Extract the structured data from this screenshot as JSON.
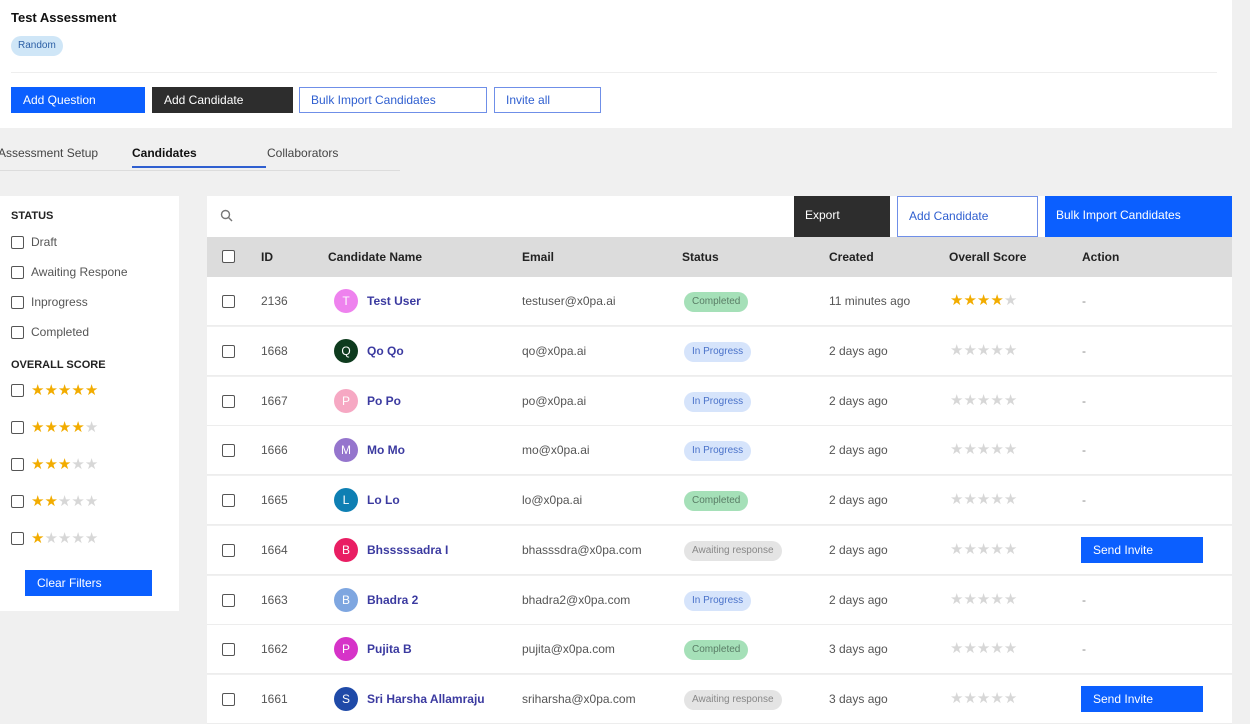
{
  "header": {
    "title": "Test Assessment",
    "badge": "Random",
    "buttons": {
      "add_question": "Add Question",
      "add_candidate": "Add Candidate",
      "bulk_import": "Bulk Import Candidates",
      "invite_all": "Invite all"
    }
  },
  "tabs": [
    {
      "label": "Assessment Setup",
      "active": false
    },
    {
      "label": "Candidates",
      "active": true
    },
    {
      "label": "Collaborators",
      "active": false
    }
  ],
  "filters": {
    "status_title": "STATUS",
    "status_options": [
      "Draft",
      "Awaiting Respone",
      "Inprogress",
      "Completed"
    ],
    "score_title": "OVERALL SCORE",
    "score_options": [
      5,
      4,
      3,
      2,
      1
    ],
    "clear_label": "Clear Filters"
  },
  "toolbar": {
    "search_placeholder": "",
    "export_label": "Export",
    "add_candidate_label": "Add Candidate",
    "bulk_import_label": "Bulk Import Candidates"
  },
  "table": {
    "columns": [
      "ID",
      "Candidate Name",
      "Email",
      "Status",
      "Created",
      "Overall Score",
      "Action"
    ],
    "rows": [
      {
        "id": "2136",
        "name": "Test User",
        "initial": "T",
        "avatar_color": "#ee82ee",
        "email": "testuser@x0pa.ai",
        "status": "Completed",
        "created": "11 minutes ago",
        "score": 4,
        "action": "-"
      },
      {
        "id": "1668",
        "name": "Qo Qo",
        "initial": "Q",
        "avatar_color": "#0e3b1e",
        "email": "qo@x0pa.ai",
        "status": "In Progress",
        "created": "2 days ago",
        "score": 0,
        "action": "-"
      },
      {
        "id": "1667",
        "name": "Po Po",
        "initial": "P",
        "avatar_color": "#f6a8c3",
        "email": "po@x0pa.ai",
        "status": "In Progress",
        "created": "2 days ago",
        "score": 0,
        "action": "-"
      },
      {
        "id": "1666",
        "name": "Mo Mo",
        "initial": "M",
        "avatar_color": "#9575cd",
        "email": "mo@x0pa.ai",
        "status": "In Progress",
        "created": "2 days ago",
        "score": 0,
        "action": "-"
      },
      {
        "id": "1665",
        "name": "Lo Lo",
        "initial": "L",
        "avatar_color": "#0e7fb3",
        "email": "lo@x0pa.ai",
        "status": "Completed",
        "created": "2 days ago",
        "score": 0,
        "action": "-"
      },
      {
        "id": "1664",
        "name": "Bhsssssadra I",
        "initial": "B",
        "avatar_color": "#e91e63",
        "email": "bhasssdra@x0pa.com",
        "status": "Awaiting response",
        "created": "2 days ago",
        "score": 0,
        "action": "Send Invite"
      },
      {
        "id": "1663",
        "name": "Bhadra 2",
        "initial": "B",
        "avatar_color": "#7ea6e0",
        "email": "bhadra2@x0pa.com",
        "status": "In Progress",
        "created": "2 days ago",
        "score": 0,
        "action": "-"
      },
      {
        "id": "1662",
        "name": "Pujita B",
        "initial": "P",
        "avatar_color": "#d633c8",
        "email": "pujita@x0pa.com",
        "status": "Completed",
        "created": "3 days ago",
        "score": 0,
        "action": "-"
      },
      {
        "id": "1661",
        "name": "Sri Harsha Allamraju",
        "initial": "S",
        "avatar_color": "#1f4aa8",
        "email": "sriharsha@x0pa.com",
        "status": "Awaiting response",
        "created": "3 days ago",
        "score": 0,
        "action": "Send Invite"
      }
    ]
  },
  "colors": {
    "primary": "#0b5fff",
    "dark_button": "#2d2d2d",
    "star_on": "#f2ac00",
    "star_off": "#d7d7d7",
    "completed_bg": "#a5e0b8",
    "in_progress_bg": "#d6e4fb",
    "awaiting_bg": "#e4e4e4"
  }
}
